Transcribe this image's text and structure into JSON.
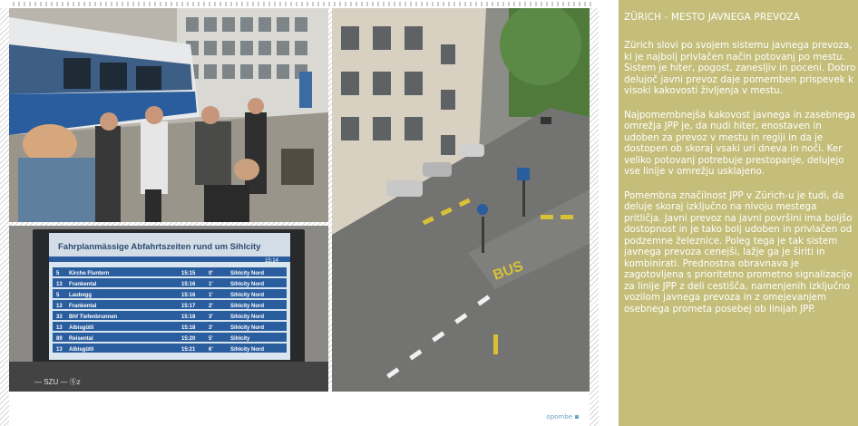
{
  "article": {
    "title": "ZÜRICH - MESTO JAVNEGA PREVOZA",
    "paragraphs": [
      "Zürich slovi po svojem sistemu javnega prevoza, ki je najbolj privlačen način potovanj po mestu. Sistem je hiter, pogost, zanesljiv in poceni. Dobro delujoč javni prevoz daje pomemben prispevek k visoki kakovosti življenja v mestu.",
      "Najpomembnejša kakovost javnega in zasebnega omrežja JPP je, da nudi hiter, enostaven in udoben za prevoz v mestu in regiji in da je dostopen ob skoraj vsaki uri dneva in noči. Ker veliko potovanj potrebuje prestopanje, delujejo vse linije v omrežju usklajeno.",
      "Pomembna značilnost JPP v Zürich-u je tudi, da deluje skoraj izključno na nivoju mestega pritličja. Javni prevoz na javni površini ima boljšo dostopnost in je tako bolj udoben in privlačen od podzemne železnice. Poleg tega je tak sistem javnega prevoza cenejši, lažje ga je širiti in kombinirati. Prednostna obravnava je zagotovljena s prioritetno prometno signalizacijo za linije JPP z deli cestišča, namenjenih izključno vozilom javnega prevoza in z omejevanjem osebnega prometa posebej ob linijah JPP."
    ]
  },
  "footer": {
    "note_label": "opombe"
  },
  "photos": {
    "board": {
      "title": "Fahrplanmässige Abfahrtszeiten rund um Sihlcity",
      "clock": "15:14",
      "rows": [
        [
          "5",
          "Kirche Fluntern",
          "15:15",
          "0'",
          "Sihlcity Nord"
        ],
        [
          "13",
          "Frankental",
          "15:16",
          "1'",
          "Sihlcity Nord"
        ],
        [
          "5",
          "Laubegg",
          "15:16",
          "1'",
          "Sihlcity Nord"
        ],
        [
          "13",
          "Frankental",
          "15:17",
          "2'",
          "Sihlcity Nord"
        ],
        [
          "33",
          "Bhf Tiefenbrunnen",
          "15:18",
          "3'",
          "Sihlcity Nord"
        ],
        [
          "13",
          "Albisgütli",
          "15:18",
          "3'",
          "Sihlcity Nord"
        ],
        [
          "89",
          "Reisental",
          "15:20",
          "5'",
          "Sihlcity"
        ],
        [
          "13",
          "Albisgütli",
          "15:21",
          "6'",
          "Sihlcity Nord"
        ]
      ],
      "logo_text": "—  SZU  —  Ⓢz"
    },
    "street": {
      "road_marking": "BUS"
    }
  },
  "colors": {
    "article_bg": "#c4be7a",
    "accent": "#67a7c3",
    "board_screen": "#d9e6f0",
    "tram_blue": "#2a5d9e"
  }
}
